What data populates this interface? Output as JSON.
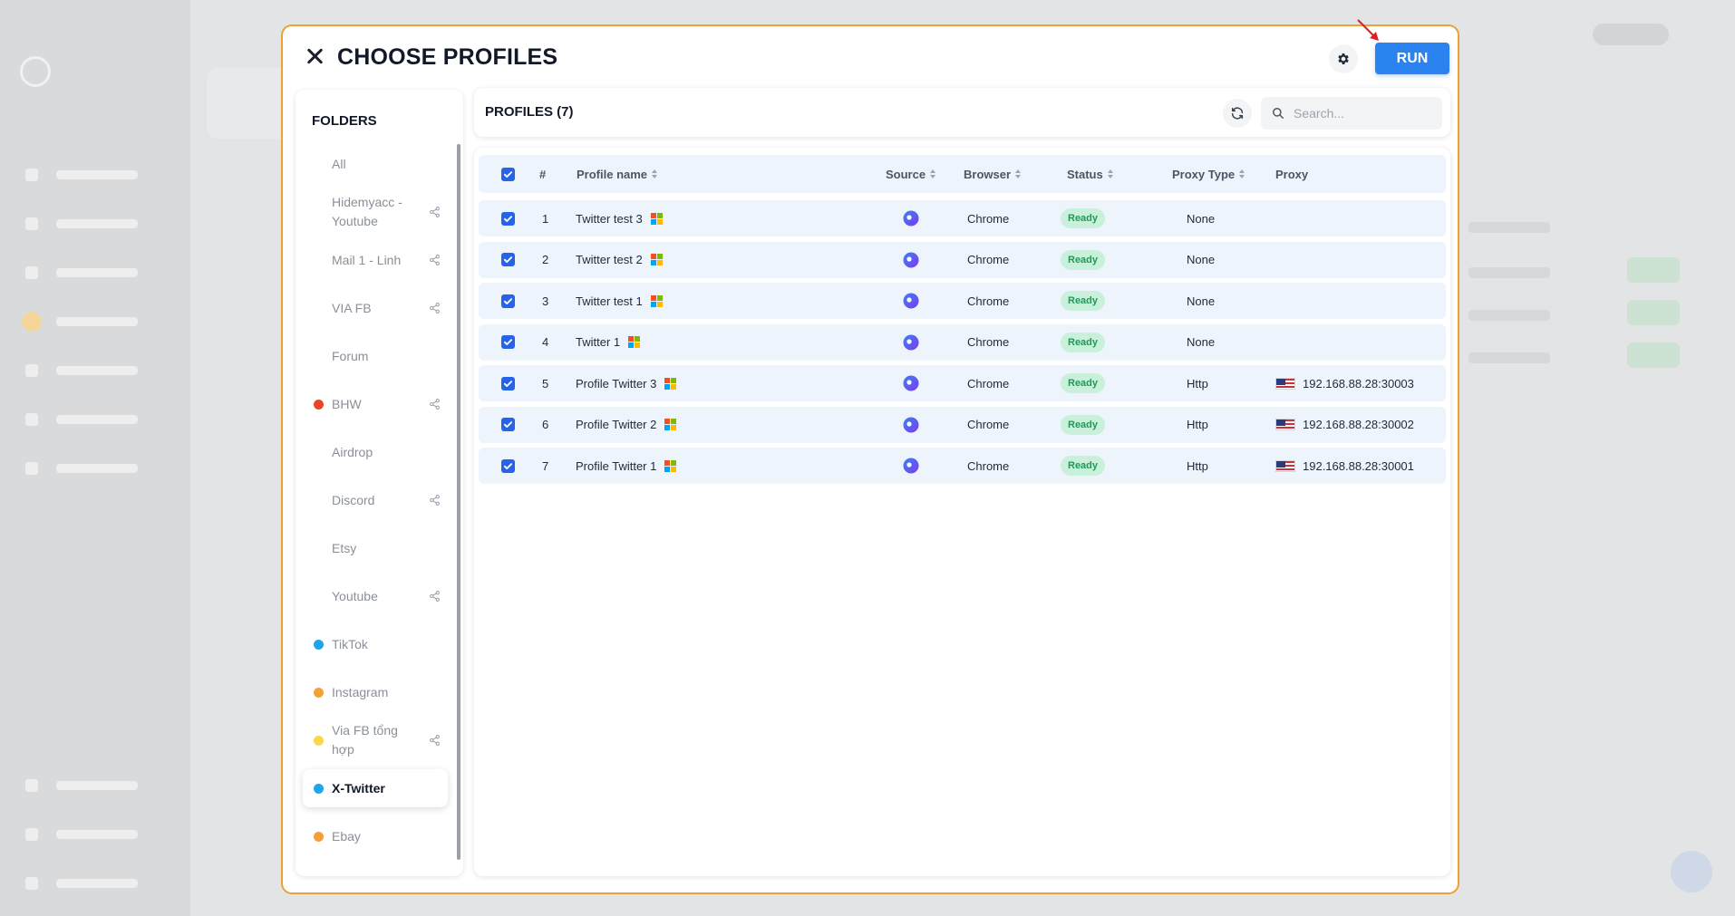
{
  "modal": {
    "title": "CHOOSE PROFILES",
    "run_label": "RUN"
  },
  "folders": {
    "title": "FOLDERS",
    "items": [
      {
        "label": "All",
        "dot": null,
        "shared": false
      },
      {
        "label": "Hidemyacc - Youtube",
        "dot": null,
        "shared": true
      },
      {
        "label": "Mail 1 - Linh",
        "dot": null,
        "shared": true
      },
      {
        "label": "VIA FB",
        "dot": null,
        "shared": true
      },
      {
        "label": "Forum",
        "dot": null,
        "shared": false
      },
      {
        "label": "BHW",
        "dot": "#e8462a",
        "shared": true
      },
      {
        "label": "Airdrop",
        "dot": null,
        "shared": false
      },
      {
        "label": "Discord",
        "dot": null,
        "shared": true
      },
      {
        "label": "Etsy",
        "dot": null,
        "shared": false
      },
      {
        "label": "Youtube",
        "dot": null,
        "shared": true
      },
      {
        "label": "TikTok",
        "dot": "#1ea7e8",
        "shared": false
      },
      {
        "label": "Instagram",
        "dot": "#f2a13a",
        "shared": false
      },
      {
        "label": "Via FB tổng hợp",
        "dot": "#f7da4a",
        "shared": true
      },
      {
        "label": "X-Twitter",
        "dot": "#1ea7e8",
        "shared": false,
        "active": true
      },
      {
        "label": "Ebay",
        "dot": "#f2a13a",
        "shared": false
      }
    ]
  },
  "profiles": {
    "title": "PROFILES (7)",
    "search_placeholder": "Search...",
    "columns": {
      "index": "#",
      "name": "Profile name",
      "source": "Source",
      "browser": "Browser",
      "status": "Status",
      "proxy_type": "Proxy Type",
      "proxy": "Proxy"
    },
    "rows": [
      {
        "index": "1",
        "name": "Twitter test 3",
        "browser": "Chrome",
        "status": "Ready",
        "proxy_type": "None",
        "proxy": ""
      },
      {
        "index": "2",
        "name": "Twitter test 2",
        "browser": "Chrome",
        "status": "Ready",
        "proxy_type": "None",
        "proxy": ""
      },
      {
        "index": "3",
        "name": "Twitter test 1",
        "browser": "Chrome",
        "status": "Ready",
        "proxy_type": "None",
        "proxy": ""
      },
      {
        "index": "4",
        "name": "Twitter 1",
        "browser": "Chrome",
        "status": "Ready",
        "proxy_type": "None",
        "proxy": ""
      },
      {
        "index": "5",
        "name": "Profile Twitter 3",
        "browser": "Chrome",
        "status": "Ready",
        "proxy_type": "Http",
        "proxy": "192.168.88.28:30003"
      },
      {
        "index": "6",
        "name": "Profile Twitter 2",
        "browser": "Chrome",
        "status": "Ready",
        "proxy_type": "Http",
        "proxy": "192.168.88.28:30002"
      },
      {
        "index": "7",
        "name": "Profile Twitter 1",
        "browser": "Chrome",
        "status": "Ready",
        "proxy_type": "Http",
        "proxy": "192.168.88.28:30001"
      }
    ]
  },
  "colors": {
    "accent": "#2b83f0",
    "modal_border": "#f0a030",
    "status_ready_bg": "#c9f0db",
    "status_ready_text": "#1e9a57"
  }
}
